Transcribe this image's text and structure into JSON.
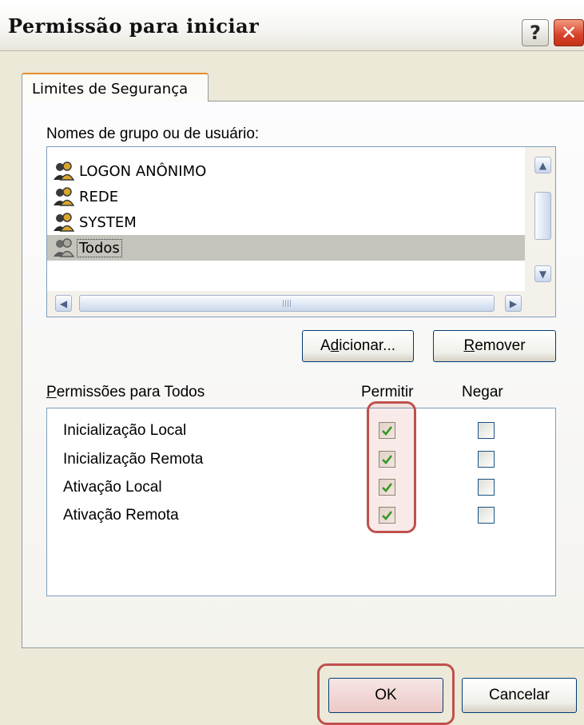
{
  "window": {
    "title": "Permissão para iniciar",
    "help_symbol": "?",
    "close_symbol": "✕"
  },
  "tabs": [
    {
      "label": "Limites de Segurança",
      "selected": true
    }
  ],
  "groups_section": {
    "label": "Nomes de grupo ou de usuário:",
    "items": [
      {
        "name": "LOGON ANÔNIMO",
        "selected": false
      },
      {
        "name": "REDE",
        "selected": false
      },
      {
        "name": "SYSTEM",
        "selected": false
      },
      {
        "name": "Todos",
        "selected": true
      }
    ]
  },
  "buttons": {
    "add": {
      "pre": "A",
      "key": "d",
      "post": "icionar..."
    },
    "remove": {
      "pre": "",
      "key": "R",
      "post": "emover"
    },
    "ok": "OK",
    "cancel": "Cancelar"
  },
  "permissions_section": {
    "label_key": "P",
    "label_rest": "ermissões para Todos",
    "col_allow": "Permitir",
    "col_deny": "Negar",
    "rows": [
      {
        "name": "Inicialização Local",
        "allow": true,
        "deny": false
      },
      {
        "name": "Inicialização Remota",
        "allow": true,
        "deny": false
      },
      {
        "name": "Ativação Local",
        "allow": true,
        "deny": false
      },
      {
        "name": "Ativação Remota",
        "allow": true,
        "deny": false
      }
    ]
  },
  "colors": {
    "highlight": "#c0504d",
    "check": "#21a121"
  },
  "icons": {
    "help": "question-mark-icon",
    "close": "close-icon",
    "group": "user-group-icon",
    "scroll_up": "arrow-up-icon",
    "scroll_down": "arrow-down-icon",
    "scroll_left": "arrow-left-icon",
    "scroll_right": "arrow-right-icon",
    "check": "checkmark-icon"
  }
}
